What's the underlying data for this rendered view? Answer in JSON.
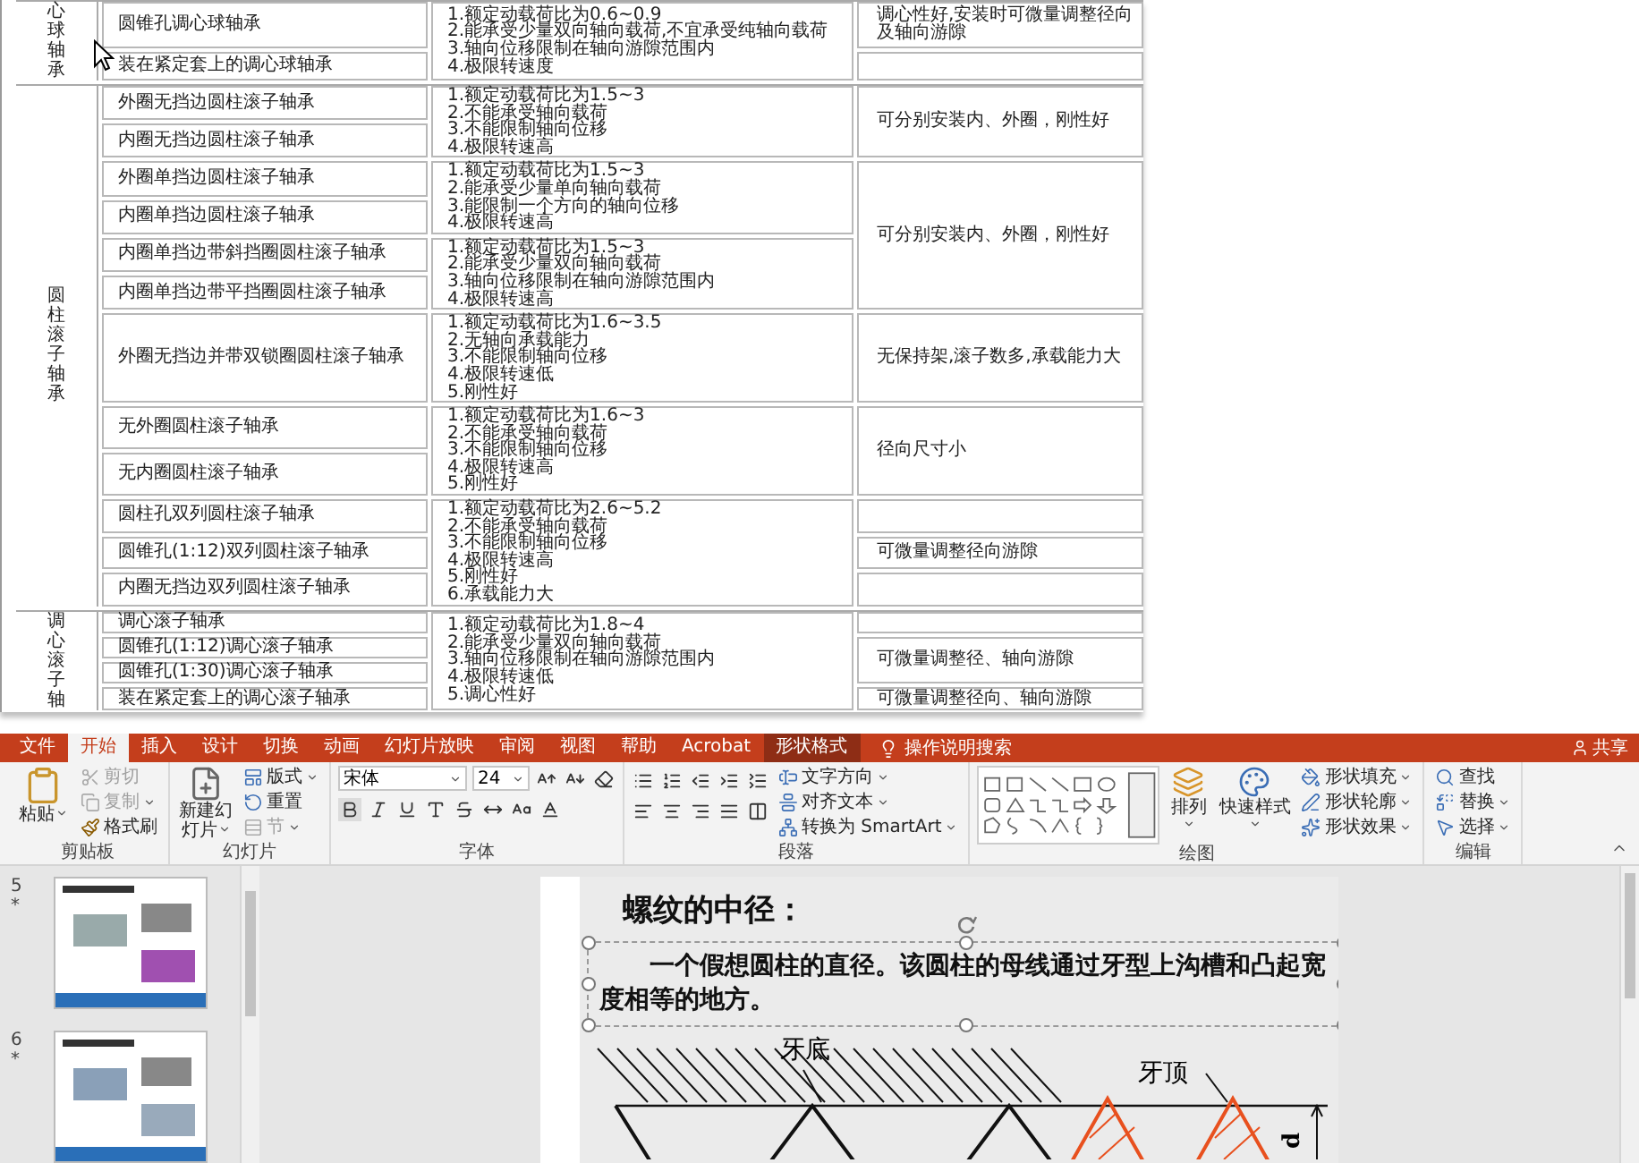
{
  "table": {
    "groups": [
      {
        "category": "心球轴承",
        "rows": [
          {
            "name": "圆锥孔调心球轴承",
            "new_property_block": true,
            "properties": [
              "1.额定动载荷比为0.6~0.9",
              "2.能承受少量双向轴向载荷,不宜承受纯轴向载荷",
              "3.轴向位移限制在轴向游隙范围内",
              "4.极限转速度"
            ],
            "new_feature_block": true,
            "feature": "调心性好,安装时可微量调整径向及轴向游隙"
          },
          {
            "name": "装在紧定套上的调心球轴承",
            "new_property_block": false,
            "new_feature_block": true
          }
        ]
      },
      {
        "category": "圆柱滚子轴承",
        "rows": [
          {
            "name": "外圈无挡边圆柱滚子轴承",
            "new_property_block": true,
            "properties": [
              "1.额定动载荷比为1.5~3",
              "2.不能承受轴向载荷",
              "3.不能限制轴向位移",
              "4.极限转速高"
            ],
            "new_feature_block": true,
            "feature": "可分别安装内、外圈，刚性好"
          },
          {
            "name": "内圈无挡边圆柱滚子轴承",
            "new_property_block": false,
            "new_feature_block": false
          },
          {
            "name": "外圈单挡边圆柱滚子轴承",
            "new_property_block": true,
            "properties": [
              "1.额定动载荷比为1.5~3",
              "2.能承受少量单向轴向载荷",
              "3.能限制一个方向的轴向位移",
              "4.极限转速高"
            ],
            "new_feature_block": true,
            "feature": "可分别安装内、外圈，刚性好"
          },
          {
            "name": "内圈单挡边圆柱滚子轴承",
            "new_property_block": false,
            "new_feature_block": false
          },
          {
            "name": "内圈单挡边带斜挡圈圆柱滚子轴承",
            "new_property_block": true,
            "properties": [
              "1.额定动载荷比为1.5~3",
              "2.能承受少量双向轴向载荷",
              "3.轴向位移限制在轴向游隙范围内",
              "4.极限转速高"
            ],
            "new_feature_block": false
          },
          {
            "name": "内圈单挡边带平挡圈圆柱滚子轴承",
            "new_property_block": false,
            "new_feature_block": false
          },
          {
            "name": "外圈无挡边并带双锁圈圆柱滚子轴承",
            "new_property_block": true,
            "properties": [
              "1.额定动载荷比为1.6~3.5",
              "2.无轴向承载能力",
              "3.不能限制轴向位移",
              "4.极限转速低",
              "5.刚性好"
            ],
            "new_feature_block": true,
            "feature": "无保持架,滚子数多,承载能力大"
          },
          {
            "name": "无外圈圆柱滚子轴承",
            "new_property_block": true,
            "properties": [
              "1.额定动载荷比为1.6~3",
              "2.不能承受轴向载荷",
              "3.不能限制轴向位移",
              "4.极限转速高",
              "5.刚性好"
            ],
            "new_feature_block": true,
            "feature": "径向尺寸小"
          },
          {
            "name": "无内圈圆柱滚子轴承",
            "new_property_block": false,
            "new_feature_block": false
          },
          {
            "name": "圆柱孔双列圆柱滚子轴承",
            "new_property_block": true,
            "properties": [
              "1.额定动载荷比为2.6~5.2",
              "2.不能承受轴向载荷",
              "3.不能限制轴向位移",
              "4.极限转速高",
              "5.刚性好",
              "6.承载能力大"
            ],
            "new_feature_block": true
          },
          {
            "name": "圆锥孔(1:12)双列圆柱滚子轴承",
            "new_property_block": false,
            "new_feature_block": true,
            "feature": "可微量调整径向游隙"
          },
          {
            "name": "内圈无挡边双列圆柱滚子轴承",
            "new_property_block": false,
            "new_feature_block": true
          }
        ]
      },
      {
        "category": "调心滚子轴",
        "rows": [
          {
            "name": "调心滚子轴承",
            "new_property_block": true,
            "properties": [
              "1.额定动载荷比为1.8~4",
              "2.能承受少量双向轴向载荷",
              "3.轴向位移限制在轴向游隙范围内",
              "4.极限转速低",
              "5.调心性好"
            ],
            "new_feature_block": true
          },
          {
            "name": "圆锥孔(1:12)调心滚子轴承",
            "new_property_block": false,
            "new_feature_block": true,
            "feature": "可微量调整径、轴向游隙"
          },
          {
            "name": "圆锥孔(1:30)调心滚子轴承",
            "new_property_block": false,
            "new_feature_block": false
          },
          {
            "name": "装在紧定套上的调心滚子轴承",
            "new_property_block": false,
            "new_feature_block": true,
            "feature": "可微量调整径向、轴向游隙"
          }
        ]
      }
    ]
  },
  "ribbon_tabs": [
    {
      "label": "文件",
      "selected": false,
      "kind": "plain"
    },
    {
      "label": "开始",
      "selected": true,
      "kind": "plain"
    },
    {
      "label": "插入",
      "selected": false,
      "kind": "plain"
    },
    {
      "label": "设计",
      "selected": false,
      "kind": "plain"
    },
    {
      "label": "切换",
      "selected": false,
      "kind": "plain"
    },
    {
      "label": "动画",
      "selected": false,
      "kind": "plain"
    },
    {
      "label": "幻灯片放映",
      "selected": false,
      "kind": "plain"
    },
    {
      "label": "审阅",
      "selected": false,
      "kind": "plain"
    },
    {
      "label": "视图",
      "selected": false,
      "kind": "plain"
    },
    {
      "label": "帮助",
      "selected": false,
      "kind": "plain"
    },
    {
      "label": "Acrobat",
      "selected": false,
      "kind": "plain"
    },
    {
      "label": "形状格式",
      "selected": false,
      "kind": "contextual"
    }
  ],
  "tell_me": "操作说明搜索",
  "share": "共享",
  "ribbon_groups": [
    {
      "title": "剪贴板",
      "kind": "clipboard",
      "items": [
        {
          "label": "粘贴",
          "dropdown": true,
          "disabled": false
        },
        {
          "label": "剪切",
          "dropdown": false,
          "disabled": true
        },
        {
          "label": "复制",
          "dropdown": true,
          "disabled": true
        },
        {
          "label": "格式刷",
          "dropdown": false,
          "disabled": false
        }
      ]
    },
    {
      "title": "幻灯片",
      "kind": "slides",
      "items": [
        {
          "label": "新建幻灯片",
          "dropdown": true,
          "disabled": false
        },
        {
          "label": "版式",
          "dropdown": true,
          "disabled": false
        },
        {
          "label": "重置",
          "dropdown": false,
          "disabled": false
        },
        {
          "label": "节",
          "dropdown": true,
          "disabled": true
        }
      ]
    },
    {
      "title": "字体",
      "kind": "font",
      "font": "宋体",
      "size": "24"
    },
    {
      "title": "段落",
      "kind": "paragraph",
      "items": [
        {
          "label": "文字方向",
          "dropdown": true,
          "disabled": false
        },
        {
          "label": "对齐文本",
          "dropdown": true,
          "disabled": false
        },
        {
          "label": "转换为 SmartArt",
          "dropdown": true,
          "disabled": false
        }
      ]
    },
    {
      "title": "绘图",
      "kind": "drawing",
      "items": [
        {
          "label": "排列",
          "dropdown": true,
          "disabled": false
        },
        {
          "label": "快速样式",
          "dropdown": true,
          "disabled": false
        },
        {
          "label": "形状填充",
          "dropdown": true,
          "disabled": false
        },
        {
          "label": "形状轮廓",
          "dropdown": true,
          "disabled": false
        },
        {
          "label": "形状效果",
          "dropdown": true,
          "disabled": false
        }
      ]
    },
    {
      "title": "编辑",
      "kind": "editing",
      "items": [
        {
          "label": "查找",
          "dropdown": false,
          "disabled": false
        },
        {
          "label": "替换",
          "dropdown": true,
          "disabled": false
        },
        {
          "label": "选择",
          "dropdown": true,
          "disabled": false
        }
      ]
    }
  ],
  "slides_panel": [
    {
      "number": "5",
      "mark": "*",
      "selected": false
    },
    {
      "number": "6",
      "mark": "*",
      "selected": false
    }
  ],
  "slide": {
    "title": "螺纹的中径：",
    "paragraph": "一个假想圆柱的直径。该圆柱的母线通过牙型上沟槽和凸起宽度相等的地方。",
    "textbox_selected": true,
    "labels": [
      {
        "text": "牙底",
        "kind": "root"
      },
      {
        "text": "牙顶",
        "kind": "crest"
      },
      {
        "text": "d",
        "kind": "dimension"
      }
    ]
  }
}
